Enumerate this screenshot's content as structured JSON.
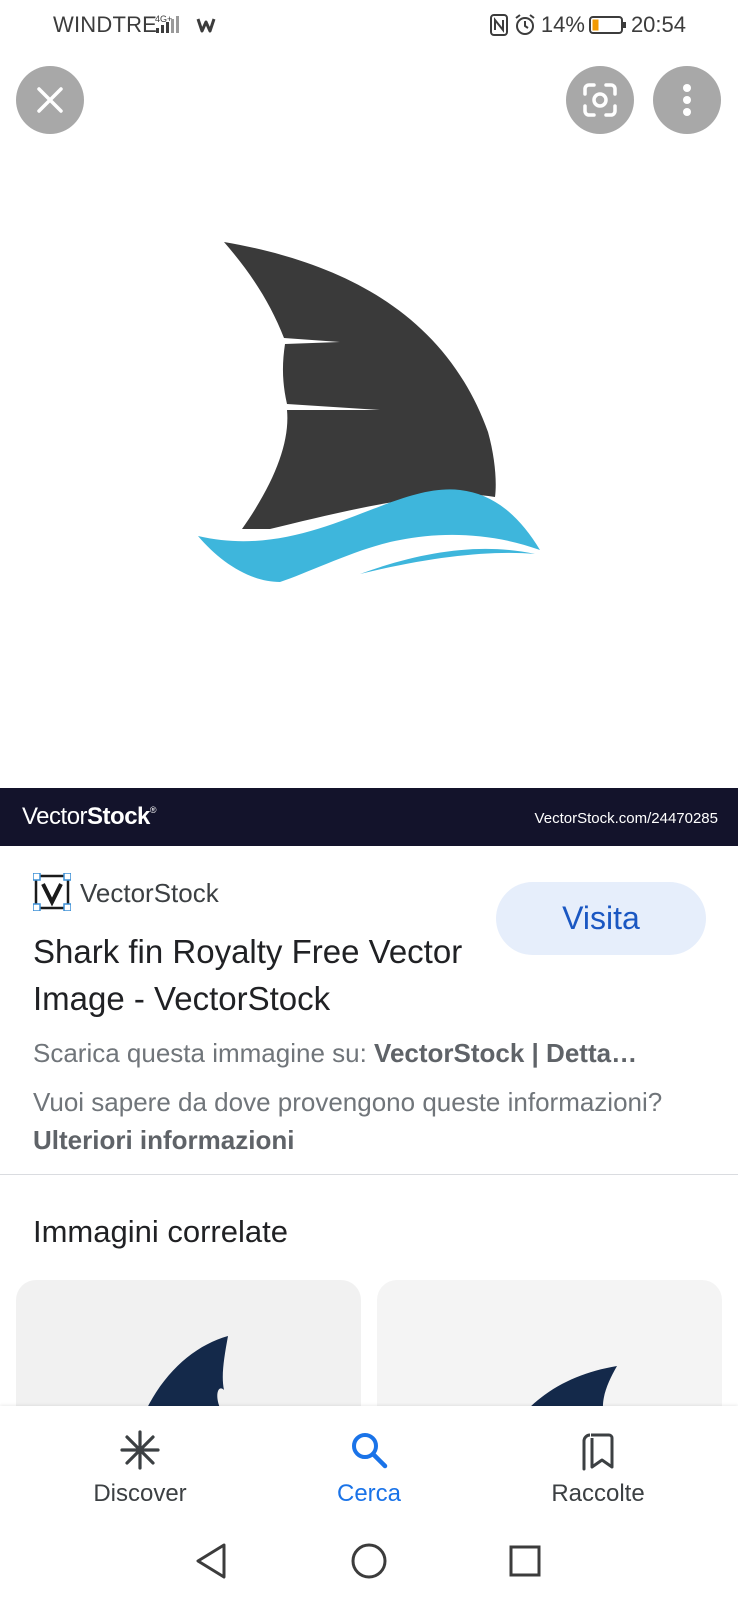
{
  "status_bar": {
    "carrier": "WINDTRE",
    "battery_percent": "14%",
    "time": "20:54",
    "icons": [
      "signal-4g-icon",
      "carrier-w-icon",
      "nfc-icon",
      "alarm-icon",
      "battery-icon"
    ]
  },
  "viewer": {
    "close_icon": "close-icon",
    "lens_icon": "lens-icon",
    "more_icon": "more-vert-icon"
  },
  "watermark": {
    "brand_light": "Vector",
    "brand_bold": "Stock",
    "brand_mark": "®",
    "url": "VectorStock.com/24470285"
  },
  "result": {
    "source_name": "VectorStock",
    "visit_label": "Visita",
    "title": "Shark fin Royalty Free Vector Image - VectorStock",
    "download_prefix": "Scarica questa immagine su: ",
    "download_source": "VectorStock | Detta…",
    "info_prefix": "Vuoi sapere da dove provengono queste informazioni? ",
    "info_link": "Ulteriori informazioni"
  },
  "related": {
    "heading": "Immagini correlate"
  },
  "bottom_nav": {
    "discover": "Discover",
    "search": "Cerca",
    "collections": "Raccolte"
  },
  "colors": {
    "accent": "#1a73e8",
    "visit_bg": "#e6eefb",
    "fin": "#3a3a3a",
    "wave": "#3eb6dc",
    "band": "#13132b"
  }
}
